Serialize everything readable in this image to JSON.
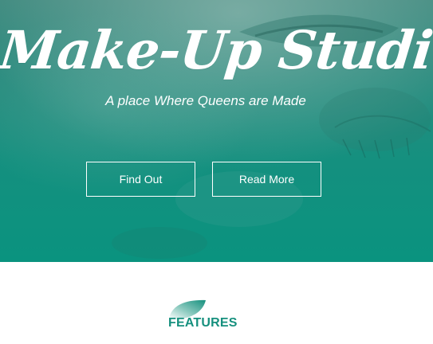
{
  "hero": {
    "title": "Make-Up Studio",
    "subtitle": "A place Where Queens are Made",
    "buttons": {
      "find_out": "Find Out",
      "read_more": "Read More"
    }
  },
  "features": {
    "title": "FEATURES",
    "icon": "leaf-icon"
  },
  "colors": {
    "accent": "#16907e",
    "hero_overlay": "#0a937f",
    "button_border": "#ffffff"
  }
}
